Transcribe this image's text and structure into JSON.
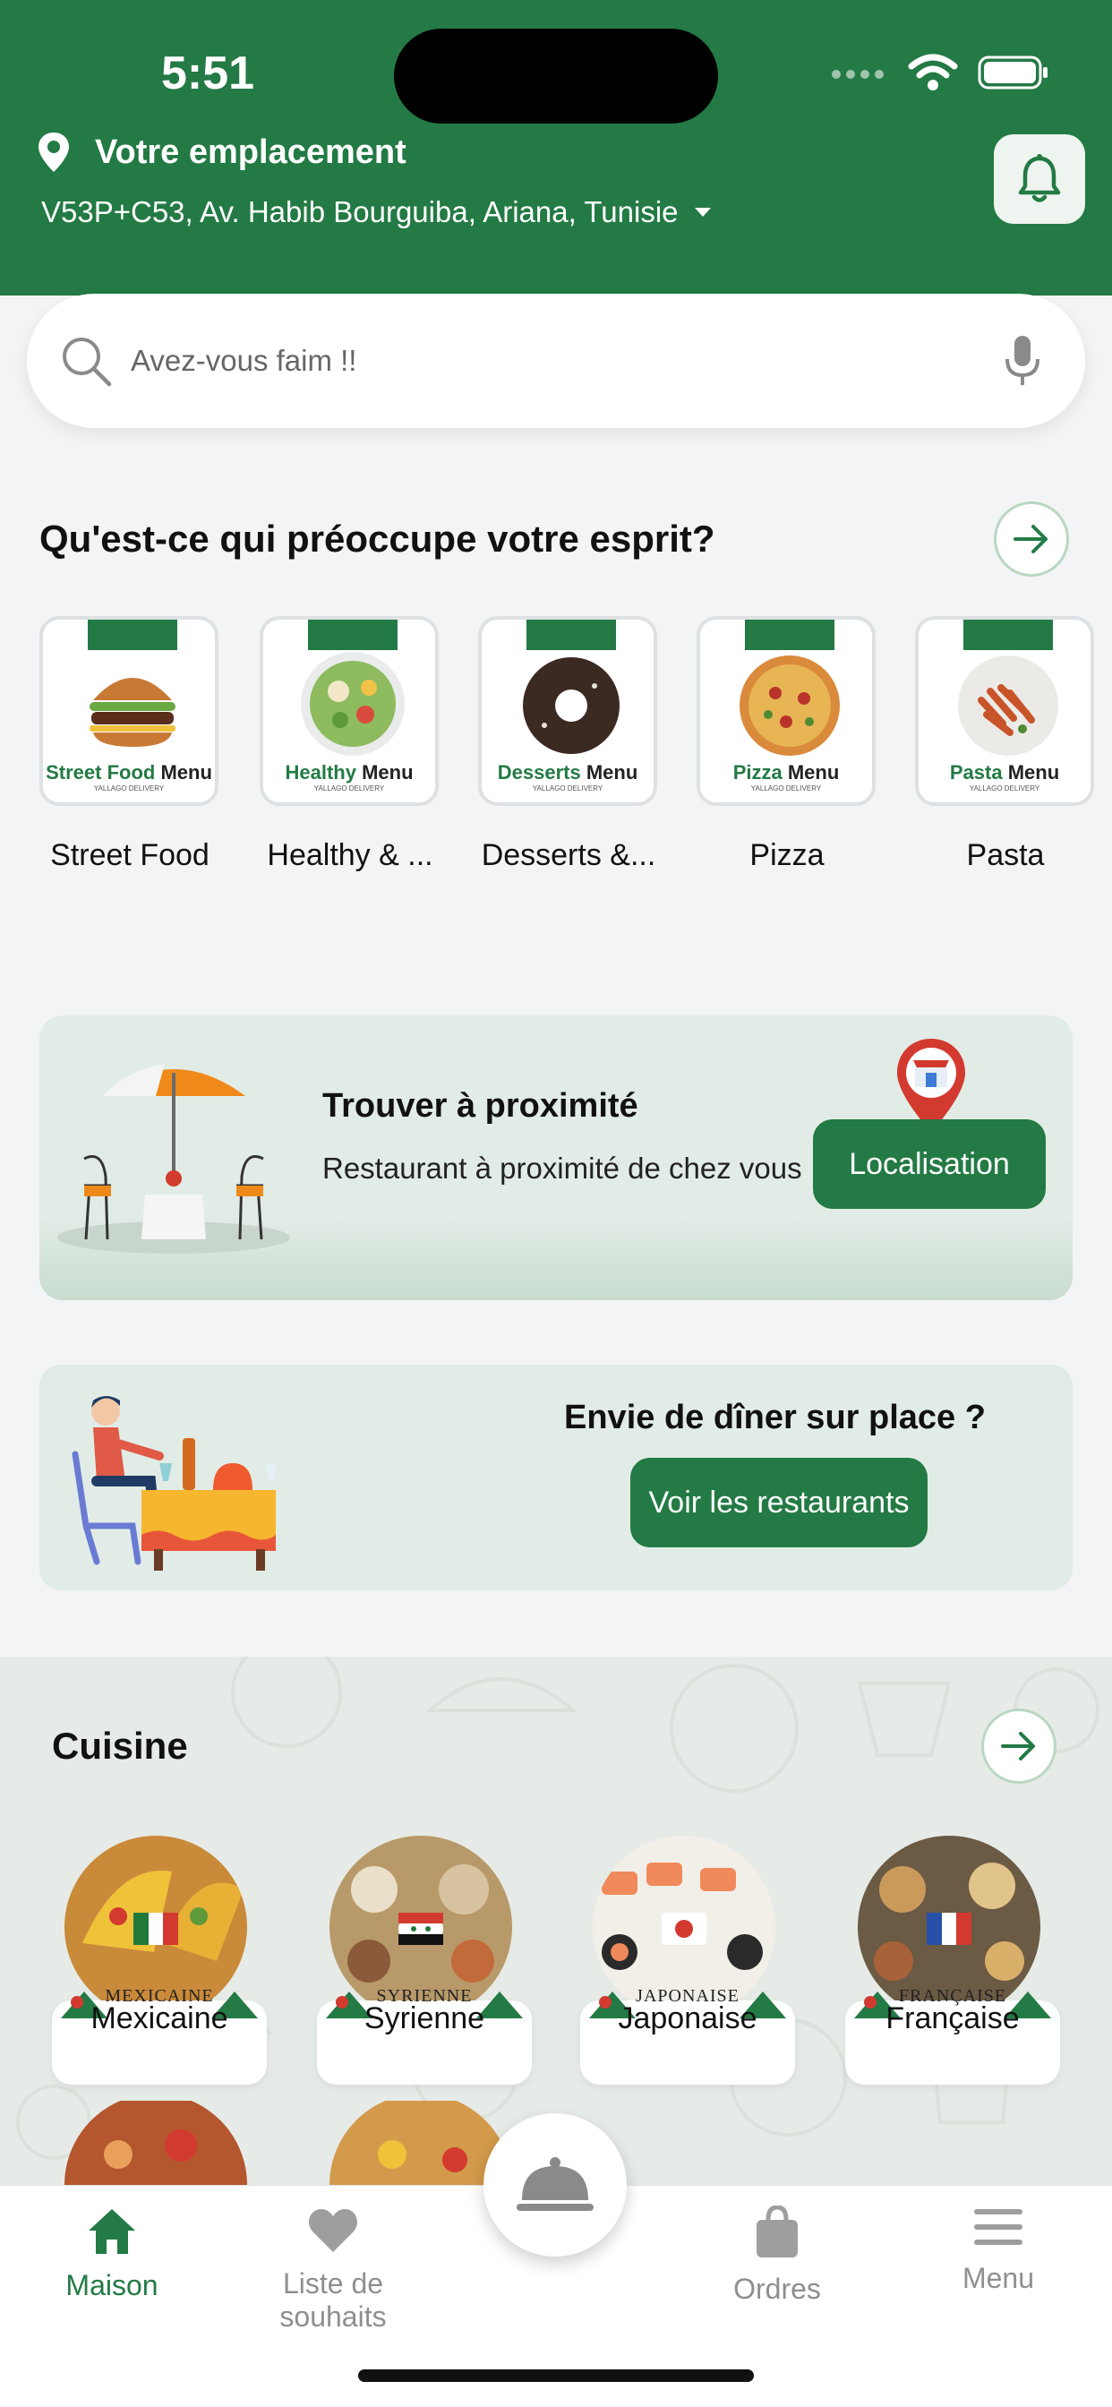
{
  "status_bar": {
    "time": "5:51"
  },
  "header": {
    "location_label": "Votre emplacement",
    "address": "V53P+C53, Av. Habib Bourguiba, Ariana, Tunisie",
    "brand_color": "#237a44"
  },
  "search": {
    "placeholder": "Avez-vous faim !!"
  },
  "categories_section": {
    "title": "Qu'est-ce qui préoccupe votre esprit?",
    "items": [
      {
        "label": "Street Food",
        "brand_a": "Street Food",
        "brand_b": "Menu",
        "sub": "YALLAGO DELIVERY",
        "food_color": "#b0652a"
      },
      {
        "label": "Healthy & ...",
        "brand_a": "Healthy",
        "brand_b": "Menu",
        "sub": "YALLAGO DELIVERY",
        "food_color": "#8dbb5e"
      },
      {
        "label": "Desserts &...",
        "brand_a": "Desserts",
        "brand_b": "Menu",
        "sub": "YALLAGO DELIVERY",
        "food_color": "#3b2a22"
      },
      {
        "label": "Pizza",
        "brand_a": "Pizza",
        "brand_b": "Menu",
        "sub": "YALLAGO DELIVERY",
        "food_color": "#d98a3b"
      },
      {
        "label": "Pasta",
        "brand_a": "Pasta",
        "brand_b": "Menu",
        "sub": "YALLAGO DELIVERY",
        "food_color": "#c8542a"
      }
    ]
  },
  "nearby": {
    "title": "Trouver à proximité",
    "text": "Restaurant à proximité de chez vous",
    "button": "Localisation"
  },
  "dine_in": {
    "title": "Envie de dîner sur place ?",
    "button": "Voir les restaurants"
  },
  "cuisine_section": {
    "title": "Cuisine",
    "items": [
      {
        "label": "Mexicaine",
        "banner": "MEXICAINE",
        "photo_color": "#c98a3a"
      },
      {
        "label": "Syrienne",
        "banner": "SYRIENNE",
        "photo_color": "#b89a6a"
      },
      {
        "label": "Japonaise",
        "banner": "JAPONAISE",
        "photo_color": "#e07a4a"
      },
      {
        "label": "Française",
        "banner": "FRANÇAISE",
        "photo_color": "#6b5a44"
      }
    ],
    "cuisine_word": "Cuisine"
  },
  "nav": {
    "items": [
      {
        "label": "Maison"
      },
      {
        "label": "Liste de souhaits"
      },
      {
        "label": "Ordres"
      },
      {
        "label": "Menu"
      }
    ]
  }
}
